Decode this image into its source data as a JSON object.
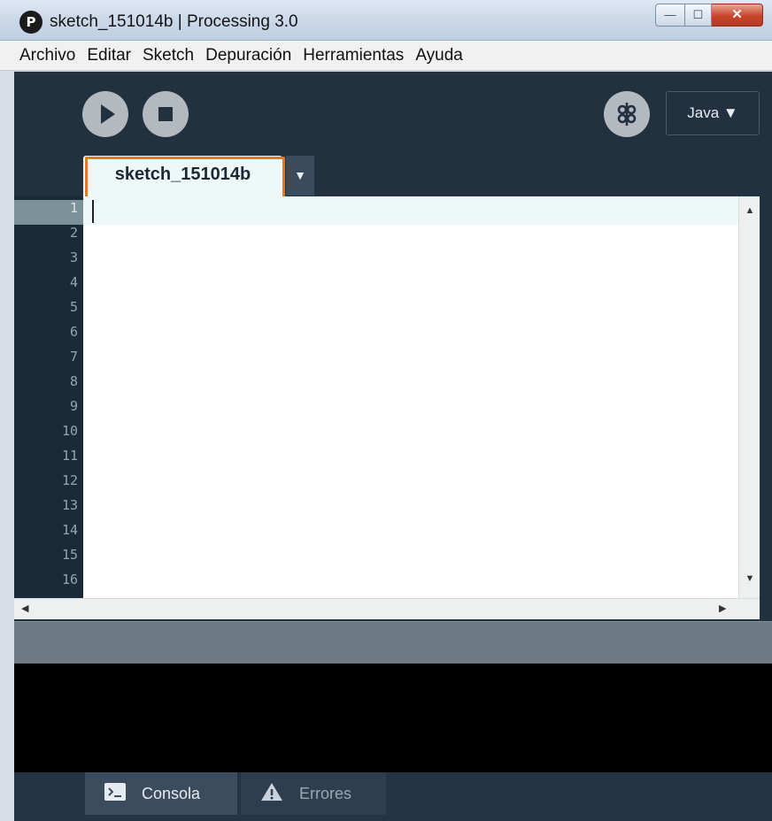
{
  "window": {
    "title": "sketch_151014b | Processing 3.0",
    "app_icon": "processing-logo-icon",
    "app_icon_glyph": "P",
    "buttons": {
      "minimize": "—",
      "maximize": "☐",
      "close": "✕"
    }
  },
  "menu": {
    "items": [
      "Archivo",
      "Editar",
      "Sketch",
      "Depuración",
      "Herramientas",
      "Ayuda"
    ]
  },
  "toolbar": {
    "run_icon": "play-icon",
    "stop_icon": "stop-icon",
    "debug_icon": "debugger-icon",
    "mode_label": "Java ▼"
  },
  "tabs": [
    {
      "label": "sketch_151014b",
      "active": true
    }
  ],
  "tab_menu_glyph": "▼",
  "editor": {
    "line_numbers": [
      "1",
      "2",
      "3",
      "4",
      "5",
      "6",
      "7",
      "8",
      "9",
      "10",
      "11",
      "12",
      "13",
      "14",
      "15",
      "16"
    ],
    "current_line": 1,
    "content": ""
  },
  "footer": {
    "console_label": "Consola",
    "errors_label": "Errores",
    "console_icon": "terminal-icon",
    "errors_icon": "warning-icon"
  },
  "colors": {
    "ide_background": "#223140",
    "highlight_border": "#e87722",
    "tab_background": "#eef8f8"
  }
}
